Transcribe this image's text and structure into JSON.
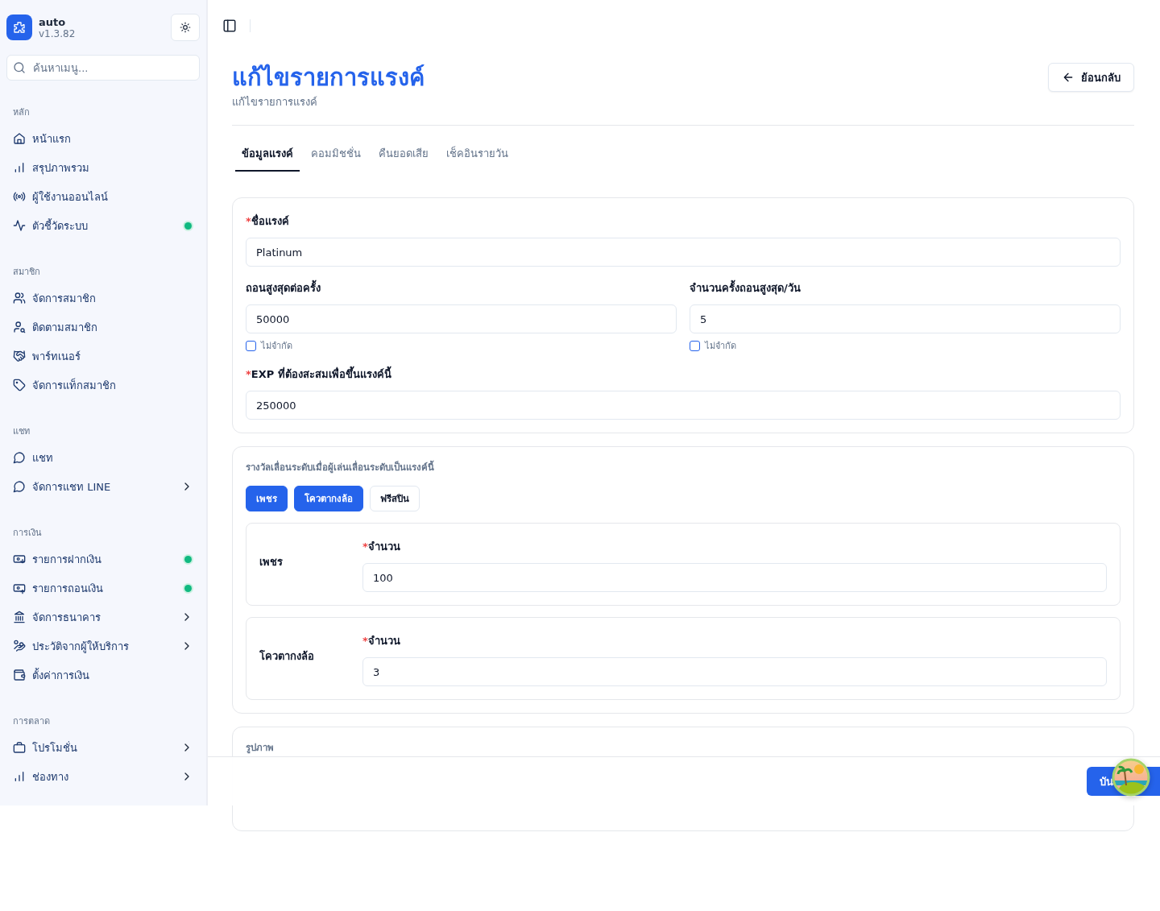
{
  "brand": {
    "name": "auto",
    "version": "v1.3.82"
  },
  "sidebar": {
    "search": {
      "placeholder": "ค้นหาเมนู..."
    },
    "sections": [
      {
        "title": "หลัก",
        "items": [
          {
            "label": "หน้าแรก",
            "submenu": false
          },
          {
            "label": "สรุปภาพรวม",
            "submenu": false
          },
          {
            "label": "ผู้ใช้งานออนไลน์",
            "submenu": false
          },
          {
            "label": "ตัวชี้วัดระบบ",
            "submenu": false,
            "color": "#10b981"
          }
        ]
      },
      {
        "title": "สมาชิก",
        "items": [
          {
            "label": "จัดการสมาชิก",
            "submenu": false
          },
          {
            "label": "ติดตามสมาชิก",
            "submenu": false
          },
          {
            "label": "พาร์ทเนอร์",
            "submenu": false
          },
          {
            "label": "จัดการแท็กสมาชิก",
            "submenu": false
          }
        ]
      },
      {
        "title": "แชท",
        "items": [
          {
            "label": "แชท",
            "submenu": false
          },
          {
            "label": "จัดการแชท LINE",
            "submenu": true
          }
        ]
      },
      {
        "title": "การเงิน",
        "items": [
          {
            "label": "รายการฝากเงิน",
            "submenu": false,
            "color": "#10b981"
          },
          {
            "label": "รายการถอนเงิน",
            "submenu": false,
            "color": "#10b981"
          },
          {
            "label": "จัดการธนาคาร",
            "submenu": true
          },
          {
            "label": "ประวัติจากผู้ให้บริการ",
            "submenu": true
          },
          {
            "label": "ตั้งค่าการเงิน",
            "submenu": false
          }
        ]
      },
      {
        "title": "การตลาด",
        "items": [
          {
            "label": "โปรโมชั่น",
            "submenu": true
          },
          {
            "label": "ช่องทาง",
            "submenu": true
          }
        ]
      }
    ]
  },
  "page": {
    "title": "แก้ไขรายการแรงค์",
    "subtitle": "แก้ไขรายการแรงค์",
    "back_button": "ย้อนกลับ"
  },
  "tabs": [
    {
      "label": "ข้อมูลแรงค์",
      "selected": true
    },
    {
      "label": "คอมมิชชั่น",
      "selected": false
    },
    {
      "label": "คืนยอดเสีย",
      "selected": false
    },
    {
      "label": "เช็คอินรายวัน",
      "selected": false
    }
  ],
  "rank_form": {
    "name": {
      "label": "ชื่อแรงค์",
      "required_mark": "*",
      "value": "Platinum"
    },
    "limits": [
      {
        "label": "ถอนสูงสุดต่อครั้ง",
        "value": "50000",
        "unlimited": {
          "label": "ไม่จำกัด",
          "checked": false
        }
      },
      {
        "label": "จำนวนครั้งถอนสูงสุด/วัน",
        "value": "5",
        "unlimited": {
          "label": "ไม่จำกัด",
          "checked": false
        }
      }
    ],
    "exp": {
      "label": "EXP ที่ต้องสะสมเพื่อขึ้นแรงค์นี้",
      "required_mark": "*",
      "value": "250000"
    }
  },
  "rewards": {
    "title": "รางวัลเลื่อนระดับเมื่อผู้เล่นเลื่อนระดับเป็นแรงค์นี้",
    "types": [
      {
        "label": "เพชร",
        "selected": true
      },
      {
        "label": "โควตากงล้อ",
        "selected": true
      },
      {
        "label": "ฟรีสปิน",
        "selected": false
      }
    ],
    "items": [
      {
        "name": "เพชร",
        "field": {
          "label": "จำนวน",
          "required_mark": "*",
          "value": "100"
        }
      },
      {
        "name": "โควตากงล้อ",
        "field": {
          "label": "จำนวน",
          "required_mark": "*",
          "value": "3"
        }
      }
    ]
  },
  "image_section": {
    "title": "รูปภาพ"
  },
  "footer": {
    "save_button": "บัน"
  }
}
